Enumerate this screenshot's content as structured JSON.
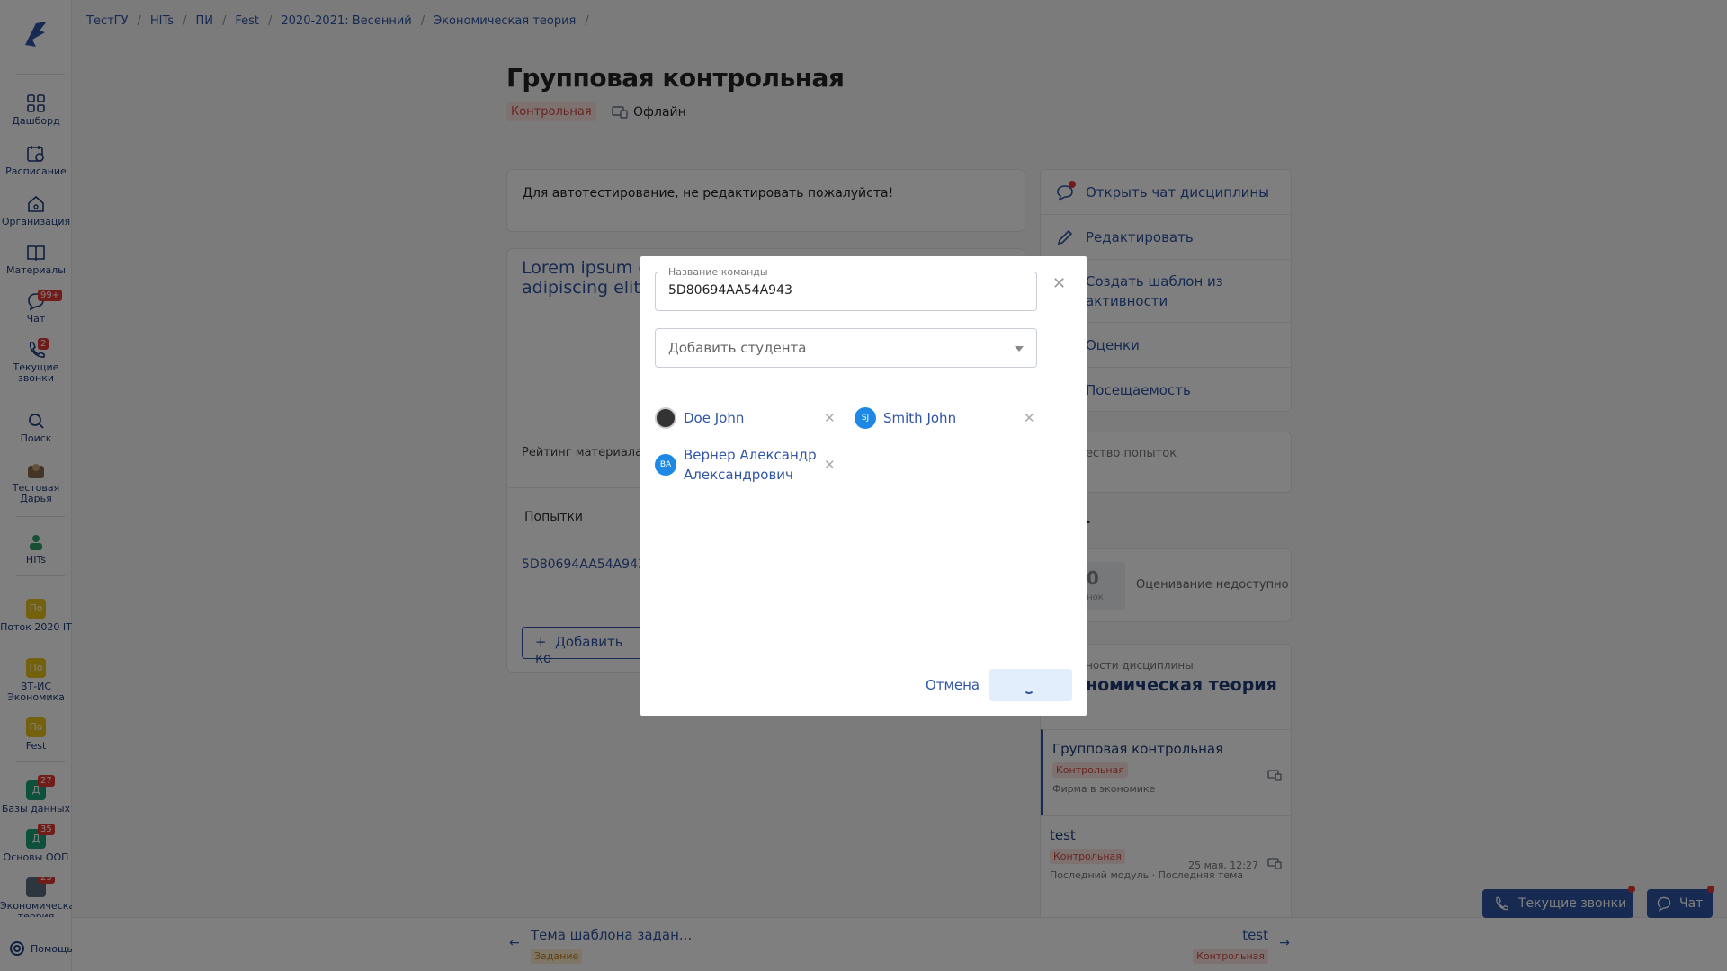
{
  "sidebar": {
    "items": [
      {
        "label": "Дашборд",
        "icon": "grid-icon"
      },
      {
        "label": "Расписание",
        "icon": "calendar-icon"
      },
      {
        "label": "Организация",
        "icon": "home-icon"
      },
      {
        "label": "Материалы",
        "icon": "book-icon"
      },
      {
        "label": "Чат",
        "icon": "chat-icon",
        "badge": "99+"
      },
      {
        "label": "Текущие звонки",
        "icon": "phone-icon",
        "badge": "2"
      },
      {
        "label": "Поиск",
        "icon": "search-icon"
      },
      {
        "label": "Тестовая Дарья",
        "icon": "avatar-icon"
      },
      {
        "label": "HITs",
        "icon": "avatar-icon"
      }
    ],
    "courses": [
      {
        "tile": "По",
        "label": "Поток 2020 IT",
        "color": "#e8c21a"
      },
      {
        "tile": "По",
        "label": "ВТ-ИС Экономика",
        "color": "#e8c21a"
      },
      {
        "tile": "По",
        "label": "Fest",
        "color": "#e8c21a"
      },
      {
        "tile": "Д",
        "label": "Базы данных",
        "color": "#1aa37a",
        "badge": "27"
      },
      {
        "tile": "Д",
        "label": "Основы ООП",
        "color": "#1aa37a",
        "badge": "35"
      },
      {
        "tile": "",
        "label": "Экономическая теория",
        "color": "#5a6b7d",
        "badge": "23"
      }
    ],
    "help": "Помощь"
  },
  "breadcrumb": [
    "ТестГУ",
    "HITs",
    "ПИ",
    "Fest",
    "2020-2021: Весенний",
    "Экономическая теория"
  ],
  "page": {
    "title": "Групповая контрольная",
    "type_tag": "Контрольная",
    "mode": "Офлайн",
    "description": "Для автотестирование, не редактировать пожалуйста!",
    "lorem": "Lorem ipsum d... adipiscing elit",
    "rating_label": "Рейтинг материала",
    "attempts_label": "Попытки",
    "attempt_code": "5D80694AA54A943",
    "add_button": "Добавить ко"
  },
  "right_panel": {
    "actions": [
      {
        "label": "Открыть чат дисциплины",
        "icon": "chat-icon"
      },
      {
        "label": "Редактировать",
        "icon": "pencil-icon"
      },
      {
        "label": "Создать шаблон из активности",
        "icon": "template-icon"
      },
      {
        "label": "Оценки",
        "icon": "grades-icon"
      },
      {
        "label": "Посещаемость",
        "icon": "attendance-icon"
      }
    ],
    "attempts_count_label": "ество попыток",
    "rating_heading": "нг",
    "grade_value": ",0",
    "grade_sub": "ценок",
    "grade_note": "Оценивание недоступно",
    "discipline_label": "ности дисциплины",
    "discipline_name": "номическая теория",
    "activities": [
      {
        "title": "Групповая контрольная",
        "tag": "Контрольная",
        "sub": "Фирма в экономике",
        "date": ""
      },
      {
        "title": "test",
        "tag": "Контрольная",
        "sub": "Последний модуль · Последняя тема",
        "date": "25 мая, 12:27"
      }
    ]
  },
  "bottom_nav": {
    "prev_title": "Тема шаблона задан...",
    "prev_tag": "Задание",
    "next_title": "test",
    "next_tag": "Контрольная"
  },
  "floating": {
    "calls": "Текущие звонки",
    "chat": "Чат"
  },
  "modal": {
    "team_label": "Название команды",
    "team_value": "5D80694AA54A943",
    "add_student_placeholder": "Добавить студента",
    "students": [
      {
        "name": "Doe John",
        "initials": ""
      },
      {
        "name": "Smith John",
        "initials": "SJ"
      },
      {
        "name": "Вернер Александр Александрович",
        "initials": "ВА"
      }
    ],
    "cancel": "Отмена"
  },
  "colors": {
    "accent": "#2f55a4",
    "danger": "#e53935",
    "overlay": "rgba(0,0,0,0.5)"
  }
}
